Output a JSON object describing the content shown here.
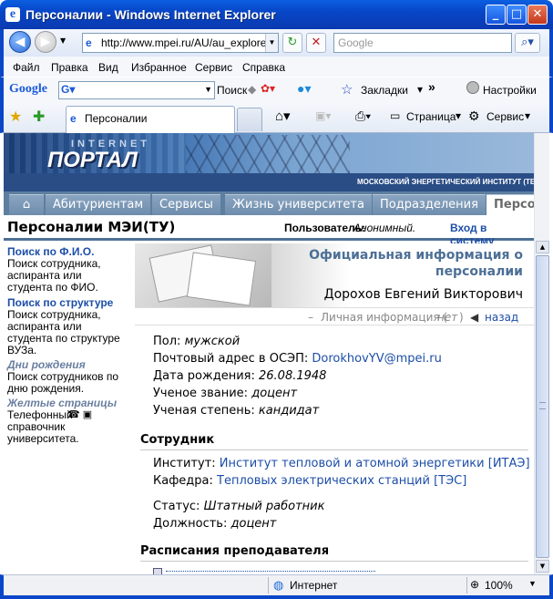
{
  "window": {
    "title": "Персоналии - Windows Internet Explorer"
  },
  "nav": {
    "address": "http://www.mpei.ru/AU/au_explorer",
    "search_placeholder": "Google"
  },
  "menu": [
    "Файл",
    "Правка",
    "Вид",
    "Избранное",
    "Сервис",
    "Справка"
  ],
  "google_bar": {
    "logo": "Google",
    "search_label": "Поиск",
    "bookmarks": "Закладки",
    "more": "»",
    "settings": "Настройки"
  },
  "favorites": {
    "tab_title": "Персоналии",
    "page": "Страница",
    "service": "Сервис"
  },
  "banner": {
    "small": "INTERNET",
    "big": "ПОРТАЛ",
    "institute": "МОСКОВСКИЙ ЭНЕРГЕТИЧЕСКИЙ ИНСТИТУТ (ТЕХН"
  },
  "tabs": [
    "Абитуриентам",
    "Сервисы",
    "Жизнь университета",
    "Подразделения",
    "Персона"
  ],
  "header": {
    "title": "Персоналии МЭИ(ТУ)",
    "user_label": "Пользователь:",
    "user_value": "Анонимный.",
    "login": "Вход в систему"
  },
  "sidebar": {
    "fio_link": "Поиск по Ф.И.О.",
    "fio_desc": "Поиск сотрудника, аспиранта или студента по ФИО.",
    "struct_link": "Поиск по структуре",
    "struct_desc": "Поиск сотрудника, аспиранта или студента по структуре ВУЗа.",
    "bday_link": "Дни рождения",
    "bday_desc": "Поиск сотрудников по дню рождения.",
    "yellow_link": "Желтые страницы",
    "yellow_desc": "Телефонный справочник университета."
  },
  "main": {
    "heading": "Официальная информация о персоналии",
    "name": "Дорохов Евгений Викторович",
    "personal": "Личная информация (",
    "personal_none": "нет",
    "personal_end": ")",
    "back": "назад",
    "gender_label": "Пол:",
    "gender": "мужской",
    "email_label": "Почтовый адрес в ОСЭП:",
    "email": "DorokhovYV@mpei.ru",
    "dob_label": "Дата рождения:",
    "dob": "26.08.1948",
    "rank_label": "Ученое звание:",
    "rank": "доцент",
    "degree_label": "Ученая степень:",
    "degree": "кандидат",
    "employee_title": "Сотрудник",
    "inst_label": "Институт:",
    "inst": "Институт тепловой и атомной энергетики [ИТАЭ]",
    "dept_label": "Кафедра:",
    "dept": "Тепловых электрических станций [ТЭС]",
    "status_label": "Статус:",
    "status": "Штатный работник",
    "position_label": "Должность:",
    "position": "доцент",
    "schedule_title": "Расписания преподавателя"
  },
  "status": {
    "zone": "Интернет",
    "zoom": "100%"
  }
}
